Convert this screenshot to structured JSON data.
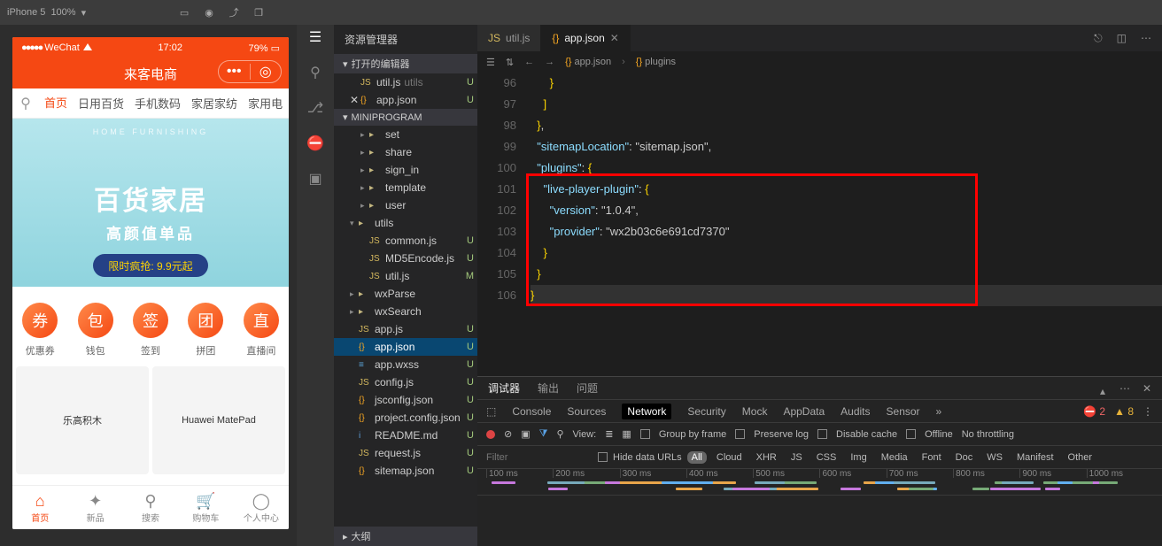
{
  "topbar": {
    "device": "iPhone 5",
    "zoom": "100%",
    "arrow": "▾"
  },
  "phone": {
    "status": {
      "carrier": "WeChat",
      "time": "17:02",
      "battery": "79%"
    },
    "title": "来客电商",
    "capsule": {
      "a": "•••",
      "b": "◎"
    },
    "tabs": [
      "首页",
      "日用百货",
      "手机数码",
      "家居家纺",
      "家用电"
    ],
    "banner": {
      "top": "HOME FURNISHING",
      "big": "百货家居",
      "sub": "高颜值单品",
      "pill": "限时疯抢: 9.9元起"
    },
    "quick": [
      {
        "icon": "券",
        "label": "优惠券"
      },
      {
        "icon": "包",
        "label": "钱包"
      },
      {
        "icon": "签",
        "label": "签到"
      },
      {
        "icon": "团",
        "label": "拼团"
      },
      {
        "icon": "直",
        "label": "直播间"
      }
    ],
    "products": [
      "乐高积木",
      "Huawei MatePad"
    ],
    "botnav": [
      {
        "icon": "⌂",
        "label": "首页"
      },
      {
        "icon": "✦",
        "label": "新品"
      },
      {
        "icon": "⚲",
        "label": "搜索"
      },
      {
        "icon": "🛒",
        "label": "购物车"
      },
      {
        "icon": "◯",
        "label": "个人中心"
      }
    ]
  },
  "explorer": {
    "title": "资源管理器",
    "openEditors": "打开的编辑器",
    "project": "MINIPROGRAM",
    "outline": "大纲",
    "open": [
      {
        "icon": "JS",
        "name": "util.js",
        "note": "utils",
        "cls": "fjs",
        "status": "U"
      },
      {
        "icon": "{}",
        "name": "app.json",
        "cls": "fjson",
        "status": "U",
        "close": true
      }
    ],
    "tree": [
      {
        "t": "folder",
        "name": "set",
        "indent": 2
      },
      {
        "t": "folder",
        "name": "share",
        "indent": 2
      },
      {
        "t": "folder",
        "name": "sign_in",
        "indent": 2
      },
      {
        "t": "folder",
        "name": "template",
        "indent": 2
      },
      {
        "t": "folder",
        "name": "user",
        "indent": 2
      },
      {
        "t": "folder",
        "name": "utils",
        "indent": 1,
        "open": true
      },
      {
        "t": "file",
        "name": "common.js",
        "icon": "JS",
        "cls": "fjs",
        "indent": 2,
        "status": "U"
      },
      {
        "t": "file",
        "name": "MD5Encode.js",
        "icon": "JS",
        "cls": "fjs",
        "indent": 2,
        "status": "U"
      },
      {
        "t": "file",
        "name": "util.js",
        "icon": "JS",
        "cls": "fjs",
        "indent": 2,
        "status": "M"
      },
      {
        "t": "folder",
        "name": "wxParse",
        "indent": 1
      },
      {
        "t": "folder",
        "name": "wxSearch",
        "indent": 1
      },
      {
        "t": "file",
        "name": "app.js",
        "icon": "JS",
        "cls": "fjs",
        "indent": 1,
        "status": "U"
      },
      {
        "t": "file",
        "name": "app.json",
        "icon": "{}",
        "cls": "fjson",
        "indent": 1,
        "status": "U",
        "sel": true
      },
      {
        "t": "file",
        "name": "app.wxss",
        "icon": "≡",
        "cls": "fwxss",
        "indent": 1,
        "status": "U"
      },
      {
        "t": "file",
        "name": "config.js",
        "icon": "JS",
        "cls": "fjs",
        "indent": 1,
        "status": "U"
      },
      {
        "t": "file",
        "name": "jsconfig.json",
        "icon": "{}",
        "cls": "fjson",
        "indent": 1,
        "status": "U"
      },
      {
        "t": "file",
        "name": "project.config.json",
        "icon": "{}",
        "cls": "fjson",
        "indent": 1,
        "status": "U"
      },
      {
        "t": "file",
        "name": "README.md",
        "icon": "i",
        "cls": "fmd",
        "indent": 1,
        "status": "U"
      },
      {
        "t": "file",
        "name": "request.js",
        "icon": "JS",
        "cls": "fjs",
        "indent": 1,
        "status": "U"
      },
      {
        "t": "file",
        "name": "sitemap.json",
        "icon": "{}",
        "cls": "fjson",
        "indent": 1,
        "status": "U"
      }
    ]
  },
  "editor": {
    "tabs": [
      {
        "icon": "JS",
        "name": "util.js",
        "cls": "fjs"
      },
      {
        "icon": "{}",
        "name": "app.json",
        "cls": "fjson",
        "active": true
      }
    ],
    "breadcrumb": [
      "app.json",
      "plugins"
    ],
    "startLine": 96,
    "lines": [
      "      }",
      "    ]",
      "  },",
      "  \"sitemapLocation\": \"sitemap.json\",",
      "  \"plugins\": {",
      "    \"live-player-plugin\": {",
      "      \"version\": \"1.0.4\",",
      "      \"provider\": \"wx2b03c6e691cd7370\"",
      "    }",
      "  }",
      "}"
    ]
  },
  "devtools": {
    "topTabs": [
      "调试器",
      "输出",
      "问题"
    ],
    "subTabs": [
      "Console",
      "Sources",
      "Network",
      "Security",
      "Mock",
      "AppData",
      "Audits",
      "Sensor"
    ],
    "errCount": "2",
    "warnCount": "8",
    "bar": {
      "view": "View:",
      "group": "Group by frame",
      "preserve": "Preserve log",
      "disable": "Disable cache",
      "offline": "Offline",
      "throttle": "No throttling"
    },
    "filter": {
      "ph": "Filter",
      "hide": "Hide data URLs",
      "chips": [
        "All",
        "Cloud",
        "XHR",
        "JS",
        "CSS",
        "Img",
        "Media",
        "Font",
        "Doc",
        "WS",
        "Manifest",
        "Other"
      ]
    },
    "ticks": [
      "100 ms",
      "200 ms",
      "300 ms",
      "400 ms",
      "500 ms",
      "600 ms",
      "700 ms",
      "800 ms",
      "900 ms",
      "1000 ms"
    ]
  }
}
